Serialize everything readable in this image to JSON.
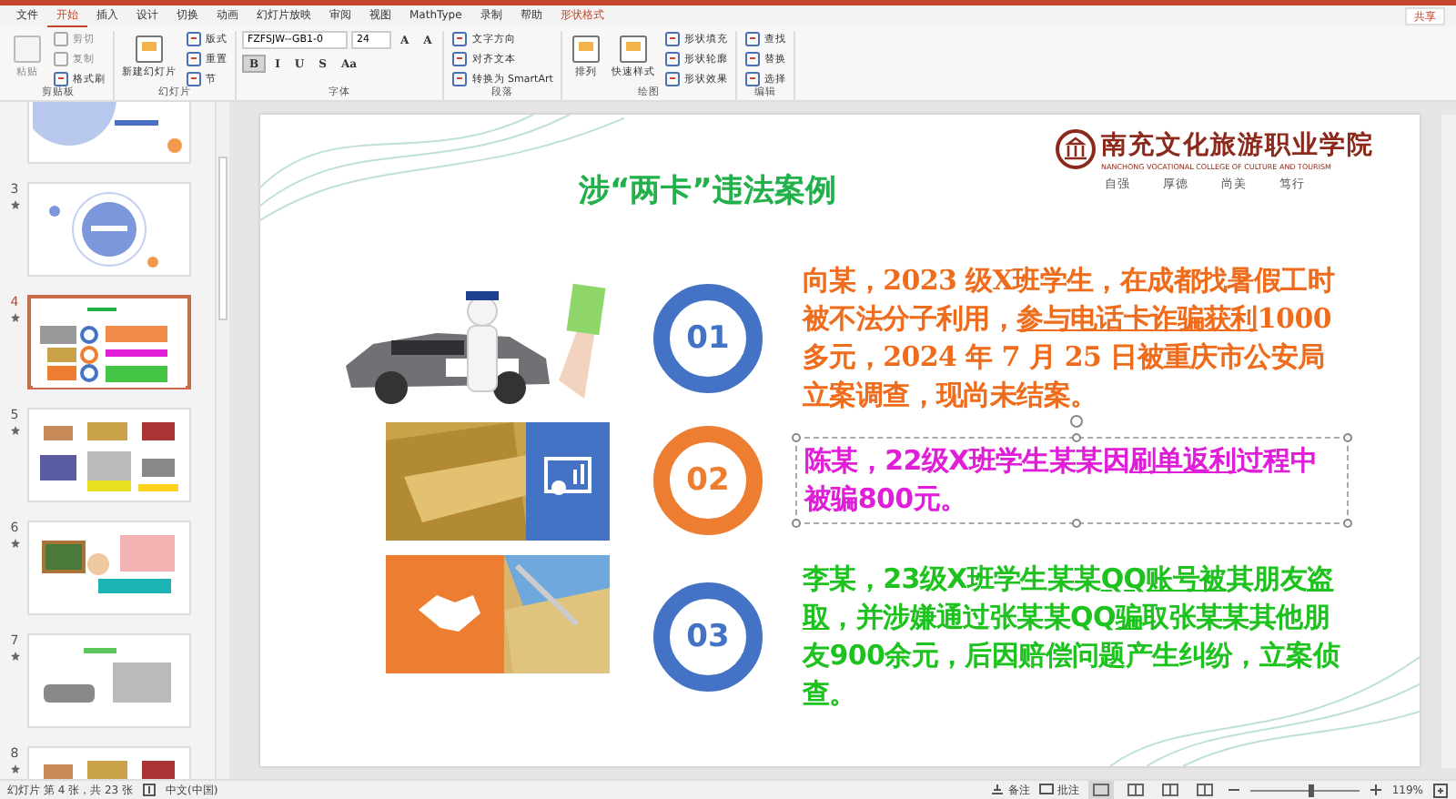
{
  "menu_tabs": [
    {
      "label": "文件",
      "selected": false,
      "kind": "plain"
    },
    {
      "label": "开始",
      "selected": true,
      "kind": "plain"
    },
    {
      "label": "插入",
      "selected": false,
      "kind": "plain"
    },
    {
      "label": "设计",
      "selected": false,
      "kind": "plain"
    },
    {
      "label": "切换",
      "selected": false,
      "kind": "plain"
    },
    {
      "label": "动画",
      "selected": false,
      "kind": "plain"
    },
    {
      "label": "幻灯片放映",
      "selected": false,
      "kind": "plain"
    },
    {
      "label": "审阅",
      "selected": false,
      "kind": "plain"
    },
    {
      "label": "视图",
      "selected": false,
      "kind": "plain"
    },
    {
      "label": "MathType",
      "selected": false,
      "kind": "plain"
    },
    {
      "label": "录制",
      "selected": false,
      "kind": "plain"
    },
    {
      "label": "帮助",
      "selected": false,
      "kind": "plain"
    },
    {
      "label": "形状格式",
      "selected": false,
      "kind": "context"
    }
  ],
  "share_button": "共享",
  "ribbon": [
    {
      "name": "剪贴板",
      "items": [
        {
          "kind": "large",
          "label": "粘贴",
          "disabled": true
        },
        {
          "kind": "small",
          "label": "剪切",
          "disabled": true
        },
        {
          "kind": "small",
          "label": "复制",
          "disabled": true
        },
        {
          "kind": "small",
          "label": "格式刷",
          "disabled": false
        }
      ]
    },
    {
      "name": "幻灯片",
      "items": [
        {
          "kind": "large",
          "label": "新建幻灯片"
        },
        {
          "kind": "small",
          "label": "版式"
        },
        {
          "kind": "small",
          "label": "重置"
        },
        {
          "kind": "small",
          "label": "节"
        }
      ]
    },
    {
      "name": "字体",
      "items": [
        {
          "kind": "field",
          "label": "FZFSJW--GB1-0"
        },
        {
          "kind": "field",
          "label": "24"
        },
        {
          "kind": "glyph",
          "label": "A"
        },
        {
          "kind": "glyph",
          "label": "A"
        },
        {
          "kind": "glyph",
          "label": "B",
          "selected": true
        },
        {
          "kind": "glyph",
          "label": "I",
          "selected": false
        },
        {
          "kind": "glyph",
          "label": "U",
          "selected": false
        },
        {
          "kind": "glyph",
          "label": "S",
          "selected": false
        },
        {
          "kind": "glyph",
          "label": "Aa"
        }
      ]
    },
    {
      "name": "段落",
      "items": [
        {
          "kind": "small",
          "label": "文字方向"
        },
        {
          "kind": "small",
          "label": "对齐文本"
        },
        {
          "kind": "small",
          "label": "转换为 SmartArt"
        }
      ]
    },
    {
      "name": "绘图",
      "items": [
        {
          "kind": "large",
          "label": "排列"
        },
        {
          "kind": "large",
          "label": "快速样式"
        },
        {
          "kind": "small",
          "label": "形状填充"
        },
        {
          "kind": "small",
          "label": "形状轮廓"
        },
        {
          "kind": "small",
          "label": "形状效果"
        }
      ]
    },
    {
      "name": "编辑",
      "items": [
        {
          "kind": "small",
          "label": "查找"
        },
        {
          "kind": "small",
          "label": "替换"
        },
        {
          "kind": "small",
          "label": "选择"
        }
      ]
    }
  ],
  "slides": [
    {
      "kind": "contents",
      "selected": false
    },
    {
      "number": "3",
      "kind": "section",
      "selected": false,
      "animated": true
    },
    {
      "number": "4",
      "kind": "cases",
      "selected": true,
      "animated": true
    },
    {
      "number": "5",
      "kind": "photos",
      "selected": false,
      "animated": true
    },
    {
      "number": "6",
      "kind": "cartoon",
      "selected": false,
      "animated": true
    },
    {
      "number": "7",
      "kind": "car",
      "selected": false,
      "animated": true
    },
    {
      "number": "8",
      "kind": "photos",
      "selected": false,
      "animated": true
    }
  ],
  "slide": {
    "title": "涉“两卡”违法案例",
    "logo": {
      "name": "南充文化旅游职业学院",
      "english": "NANCHONG VOCATIONAL COLLEGE OF CULTURE AND TOURISM",
      "motto": [
        "自强",
        "厚德",
        "尚美",
        "笃行"
      ]
    },
    "cases": [
      {
        "number": "01",
        "color": "#4472c4",
        "selected": false,
        "text": {
          "color": "#ef6c1c",
          "segments": [
            {
              "text": "向某，2023 级X班学生，在成都找暑假工时被不法分子利用，",
              "underline": false
            },
            {
              "text": "参与电话卡诈骗获利",
              "underline": true
            },
            {
              "text": "1000 多元，2024 年 7 月 25 日被重庆市公安局立案调查，现尚未结案。",
              "underline": false
            }
          ]
        }
      },
      {
        "number": "02",
        "color": "#ed7d31",
        "selected": true,
        "text": {
          "color": "#e01ed8",
          "segments": [
            {
              "text": "陈某，22级X班学生某某因",
              "underline": false
            },
            {
              "text": "刷单返利",
              "underline": true
            },
            {
              "text": "过程中被骗800元。",
              "underline": false
            }
          ]
        }
      },
      {
        "number": "03",
        "color": "#4472c4",
        "selected": false,
        "text": {
          "color": "#1ec21e",
          "segments": [
            {
              "text": "李某，23级X班学生某某",
              "underline": false
            },
            {
              "text": "QQ账号被",
              "underline": true
            },
            {
              "text": "其朋友",
              "underline": false
            },
            {
              "text": "盗取",
              "underline": true
            },
            {
              "text": "，并涉嫌通过张某某QQ",
              "underline": false
            },
            {
              "text": "骗",
              "underline": true
            },
            {
              "text": "取张某某其他朋友900余元，后因赔偿问题产生纠纷，立案侦查。",
              "underline": false
            }
          ]
        }
      }
    ]
  },
  "status_bar": {
    "slide_info": "幻灯片 第 4 张，共 23 张",
    "language": "中文(中国)",
    "notes": "备注",
    "comments": "批注",
    "zoom": "119%",
    "zoom_slider": {
      "level": 0.55
    }
  }
}
